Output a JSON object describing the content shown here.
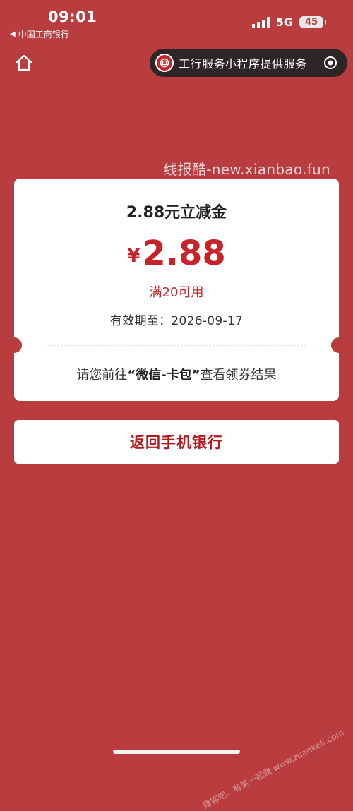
{
  "status_bar": {
    "time": "09:01",
    "back_app": "中国工商银行",
    "network": "5G",
    "battery": "45"
  },
  "capsule": {
    "text": "工行服务小程序提供服务"
  },
  "watermark": "线报酷-new.xianbao.fun",
  "coupon": {
    "title": "2.88元立减金",
    "currency": "¥",
    "amount": "2.88",
    "condition": "满20可用",
    "validity": "有效期至：2026-09-17",
    "hint_prefix": "请您前往",
    "hint_highlight": "“微信-卡包”",
    "hint_suffix": "查看领券结果"
  },
  "return_button": {
    "label": "返回手机银行"
  },
  "bottom_watermark": "赚客吧，有奖一起赚 www.zuanke8.com",
  "colors": {
    "background": "#b93d3f",
    "accent_red": "#c8232a",
    "capsule_bg": "#2e2526"
  }
}
